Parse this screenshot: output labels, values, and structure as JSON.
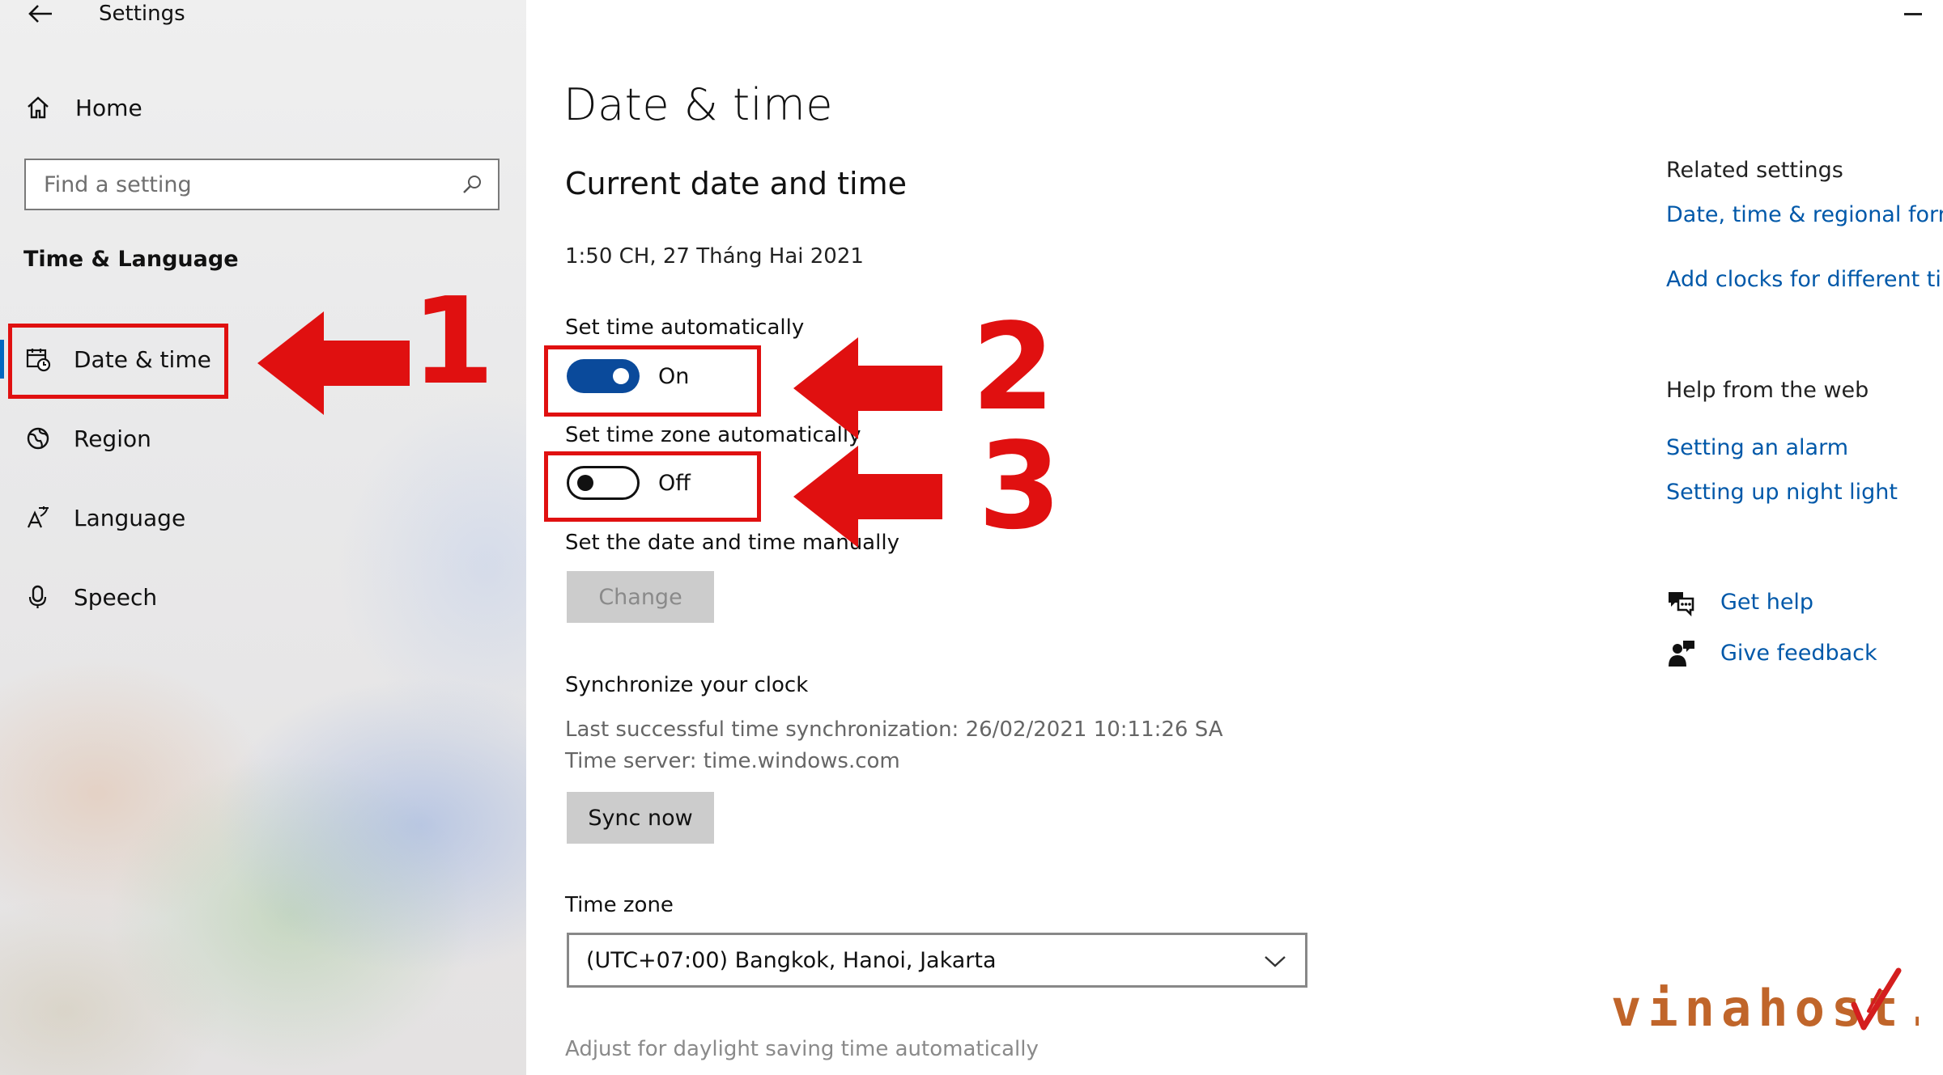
{
  "window": {
    "app_title": "Settings"
  },
  "sidebar": {
    "home_label": "Home",
    "search_placeholder": "Find a setting",
    "section_title": "Time & Language",
    "items": [
      {
        "label": "Date & time",
        "icon": "calendar-clock-icon",
        "selected": true
      },
      {
        "label": "Region",
        "icon": "globe-icon",
        "selected": false
      },
      {
        "label": "Language",
        "icon": "language-icon",
        "selected": false
      },
      {
        "label": "Speech",
        "icon": "microphone-icon",
        "selected": false
      }
    ]
  },
  "main": {
    "page_title": "Date & time",
    "current_heading": "Current date and time",
    "current_time": "1:50 CH, 27 Tháng Hai 2021",
    "set_time_auto": {
      "label": "Set time automatically",
      "state": "On"
    },
    "set_tz_auto": {
      "label": "Set time zone automatically",
      "state": "Off"
    },
    "manual": {
      "label": "Set the date and time manually",
      "button": "Change"
    },
    "sync": {
      "heading": "Synchronize your clock",
      "last_sync": "Last successful time synchronization: 26/02/2021 10:11:26 SA",
      "server": "Time server: time.windows.com",
      "button": "Sync now"
    },
    "timezone": {
      "label": "Time zone",
      "value": "(UTC+07:00) Bangkok, Hanoi, Jakarta"
    },
    "daylight_label": "Adjust for daylight saving time automatically"
  },
  "right_column": {
    "related_title": "Related settings",
    "related_links": [
      "Date, time & regional forma",
      "Add clocks for different tim"
    ],
    "help_title": "Help from the web",
    "help_links": [
      "Setting an alarm",
      "Setting up night light"
    ],
    "get_help": "Get help",
    "give_feedback": "Give feedback"
  },
  "annotations": {
    "step1": "1",
    "step2": "2",
    "step3": "3",
    "color": "#e01010"
  },
  "watermark": {
    "text": "vinahost.vn"
  },
  "colors": {
    "accent": "#0058a9",
    "toggle_on": "#0a4a9b",
    "selected_indicator": "#0067c0"
  }
}
